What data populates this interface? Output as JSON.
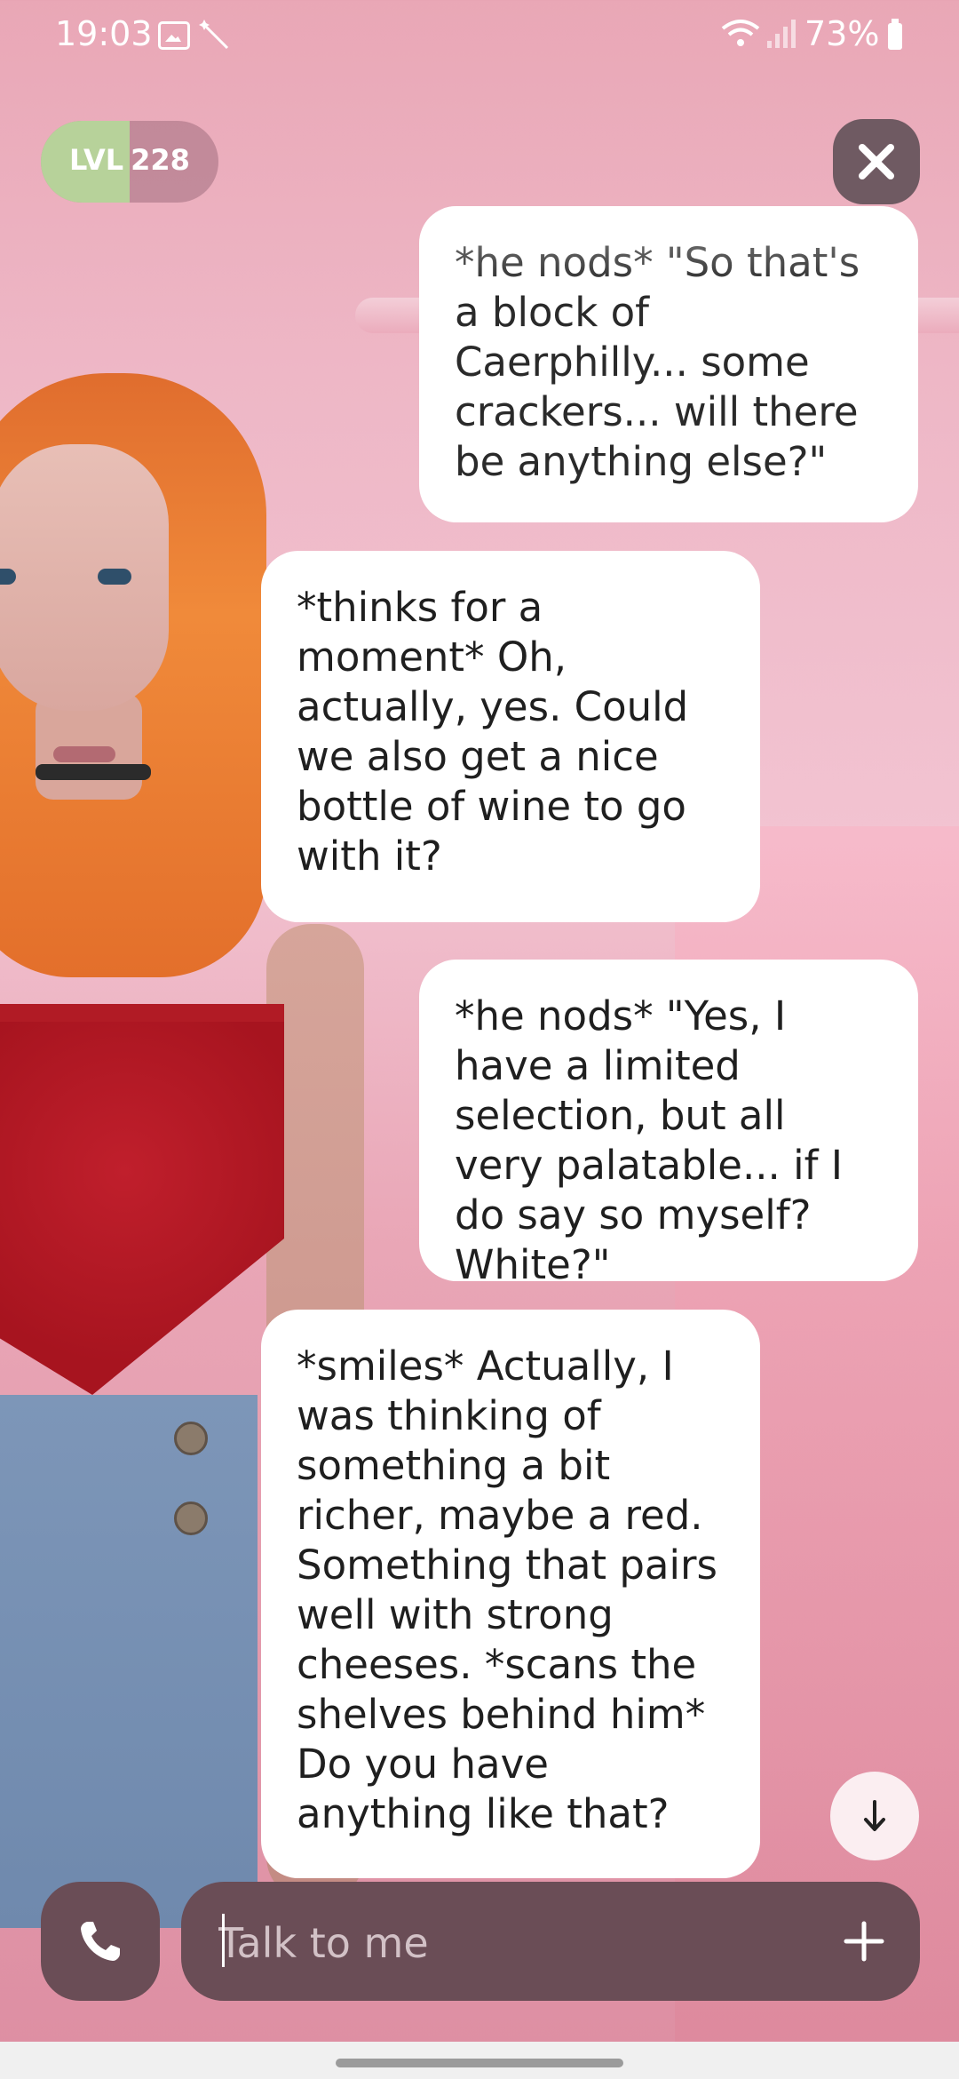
{
  "status_bar": {
    "time": "19:03",
    "battery": "73%",
    "icons": [
      "image-icon",
      "wand-icon",
      "wifi-icon",
      "signal-icon",
      "battery-icon"
    ]
  },
  "level": {
    "label": "LVL",
    "value": "228",
    "progress": 0.5
  },
  "messages": [
    {
      "role": "user",
      "text": "*he nods* \"So that's a block of Caerphilly... some crackers... will there be anything else?\""
    },
    {
      "role": "ai",
      "text": "*thinks for a moment* Oh, actually, yes. Could we also get a nice bottle of wine to go with it?"
    },
    {
      "role": "user",
      "text": "*he nods* \"Yes, I have a limited selection, but all very palatable... if I do say so myself? White?\""
    },
    {
      "role": "ai",
      "text": "*smiles* Actually, I was thinking of something a bit richer, maybe a red. Something that pairs well with strong cheeses. *scans the shelves behind him* Do you have anything like that?"
    }
  ],
  "input": {
    "placeholder": "Talk to me"
  },
  "colors": {
    "bubble": "#ffffff",
    "bar": "#6a4d56",
    "level_fill": "#b7d29a"
  }
}
